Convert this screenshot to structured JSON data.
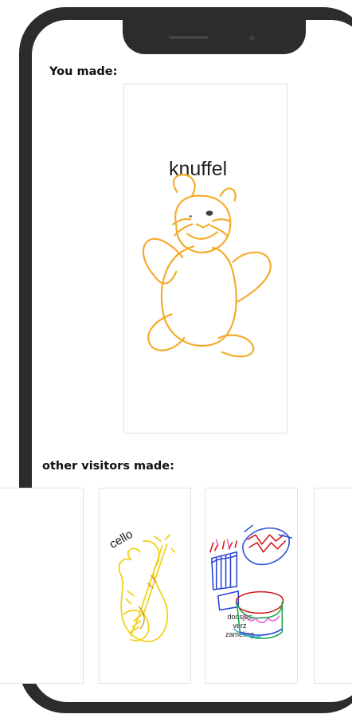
{
  "sections": {
    "you_made": "You made:",
    "others_made": "other visitors made:"
  },
  "main_drawing": {
    "label": "knuffel",
    "stroke": "#f4ab2a"
  },
  "gallery": [
    {
      "label": ""
    },
    {
      "label": "cello",
      "stroke": "#f2d21a"
    },
    {
      "label": "doosjes verzameling",
      "line1": "doosjes",
      "line2": "verz",
      "line3": "zameling"
    },
    {
      "label": ""
    }
  ],
  "colors": {
    "frame": "#2c2c2c",
    "card_border": "#e2e2e2"
  }
}
